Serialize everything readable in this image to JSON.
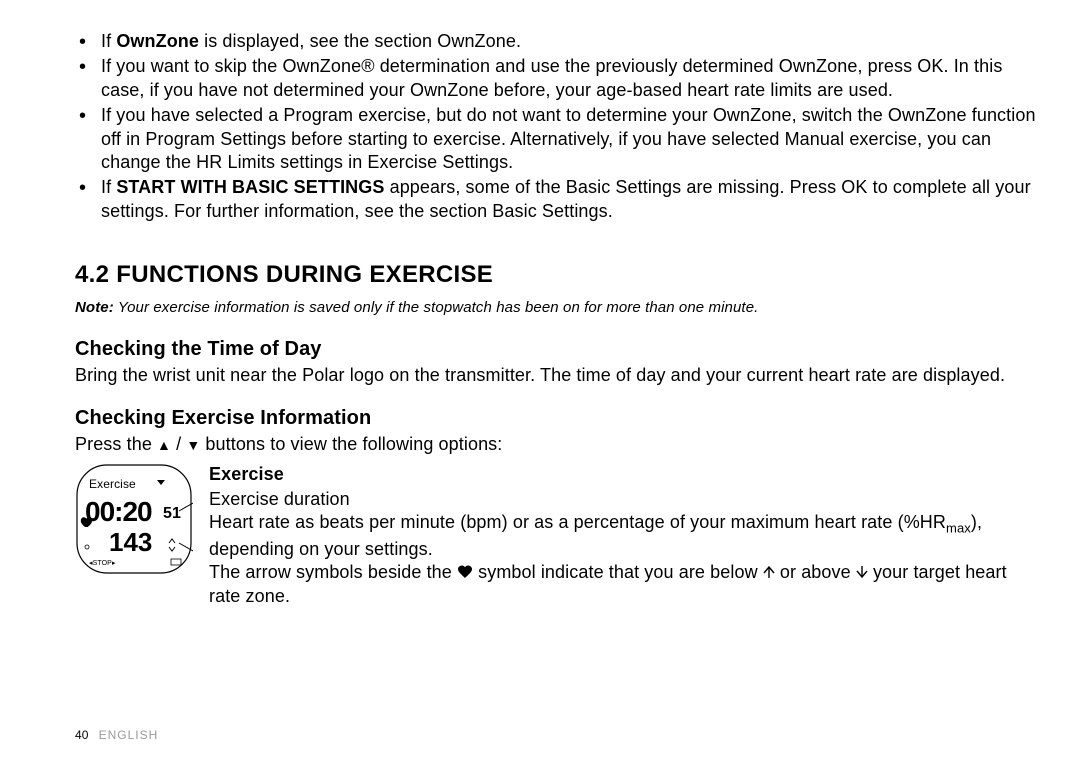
{
  "bullets": {
    "b1_pre": "If ",
    "b1_strong": "OwnZone",
    "b1_post": " is displayed, see the section OwnZone.",
    "b2": "If you want to skip the OwnZone® determination and use the previously determined OwnZone, press OK. In this case, if you have not determined your OwnZone before, your age-based heart rate limits are used.",
    "b3": "If you have selected a Program exercise, but do not want to determine your OwnZone, switch the OwnZone function off in Program Settings before starting to exercise. Alternatively, if you have selected Manual exercise, you can change the HR Limits settings in Exercise Settings.",
    "b4_pre": "If ",
    "b4_strong": "START WITH BASIC SETTINGS",
    "b4_post": " appears, some of the Basic Settings are missing. Press OK to complete all your settings. For further information, see the section Basic Settings."
  },
  "section_heading": "4.2  FUNCTIONS DURING EXERCISE",
  "note_label": "Note:",
  "note_text": " Your exercise information is saved only if the stopwatch has been on for more than one minute.",
  "sub1_heading": "Checking the Time of Day",
  "sub1_text": "Bring the wrist unit near the Polar logo on the transmitter. The time of day and your current heart rate are displayed.",
  "sub2_heading": "Checking Exercise Information",
  "sub2_text_pre": "Press the ",
  "sub2_text_post": " buttons to view the following options:",
  "watch": {
    "label": "Exercise",
    "time": "00:20",
    "sec": "51",
    "hr": "143",
    "stop": "◂STOP▸"
  },
  "exercise": {
    "title": "Exercise",
    "line1": "Exercise duration",
    "line2_a": "Heart rate as beats per minute (bpm) or as a percentage of your maximum heart rate (%HR",
    "line2_sub": "max",
    "line2_b": "), depending on your settings.",
    "line3_a": "The arrow symbols beside the ",
    "line3_b": " symbol indicate that you are below ",
    "line3_c": " or above ",
    "line3_d": " your target heart rate zone."
  },
  "footer": {
    "page": "40",
    "lang": "ENGLISH"
  }
}
